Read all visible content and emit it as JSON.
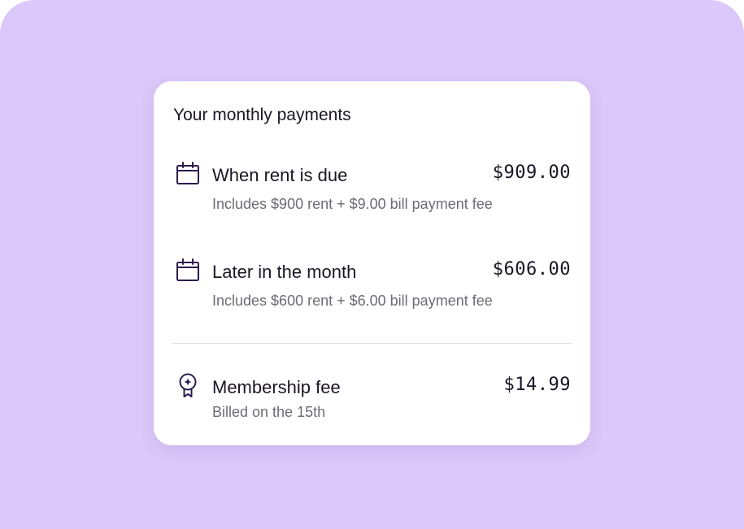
{
  "card": {
    "title": "Your monthly payments",
    "payments": [
      {
        "icon": "calendar-icon",
        "label": "When rent is due",
        "amount": "$909.00",
        "detail": "Includes $900 rent + $9.00 bill payment fee"
      },
      {
        "icon": "calendar-icon",
        "label": "Later in the month",
        "amount": "$606.00",
        "detail": "Includes $600 rent + $6.00 bill payment fee"
      }
    ],
    "membership": {
      "icon": "award-ribbon-icon",
      "label": "Membership fee",
      "amount": "$14.99",
      "detail": "Billed on the 15th"
    }
  },
  "colors": {
    "background": "#dcc8fa",
    "card": "#ffffff",
    "icon": "#2d1b4e",
    "text": "#1b1625",
    "muted": "#6e6a75"
  }
}
